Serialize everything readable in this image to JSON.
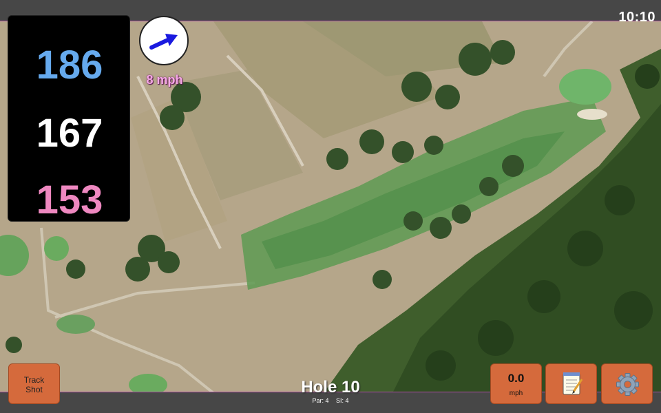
{
  "status": {
    "time": "10:10"
  },
  "distances": {
    "back": "186",
    "middle": "167",
    "front": "153"
  },
  "wind": {
    "speed_label": "8 mph",
    "direction": "northeast"
  },
  "hole": {
    "title": "Hole 10",
    "par": "Par: 4",
    "stroke_index": "SI: 4"
  },
  "buttons": {
    "track_shot_line1": "Track",
    "track_shot_line2": "Shot",
    "speed_value": "0.0",
    "speed_unit": "mph",
    "notes_icon": "notepad-icon",
    "settings_icon": "gear-icon"
  },
  "colors": {
    "back_distance": "#66aaee",
    "middle_distance": "#ffffff",
    "front_distance": "#ee88c0",
    "button": "#d56a3c",
    "wind_label": "#f5a8e6",
    "wind_arrow": "#1a1adf"
  }
}
